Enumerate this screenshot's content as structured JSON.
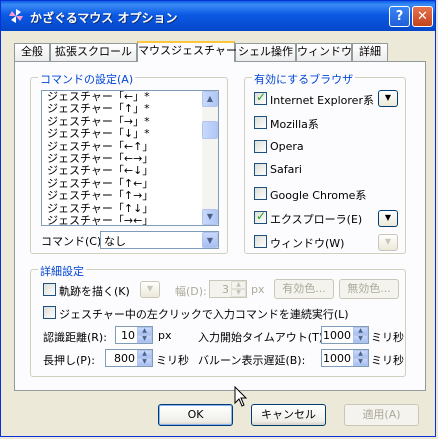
{
  "window": {
    "title": "かざぐるマウス オプション",
    "help_glyph": "?",
    "close_glyph": "✕"
  },
  "tabs": [
    "全般",
    "拡張スクロール",
    "マウスジェスチャー",
    "シェル操作",
    "ウィンドウ",
    "詳細"
  ],
  "active_tab": "マウスジェスチャー",
  "commands": {
    "legend": "コマンドの設定(A)",
    "gestures": [
      "ジェスチャー「←」*",
      "ジェスチャー「↑」*",
      "ジェスチャー「→」*",
      "ジェスチャー「↓」*",
      "ジェスチャー「←↑」",
      "ジェスチャー「←→」",
      "ジェスチャー「←↓」",
      "ジェスチャー「↑←」",
      "ジェスチャー「↑→」",
      "ジェスチャー「↑↓」",
      "ジェスチャー「→←」"
    ],
    "command_label": "コマンド(C):",
    "command_value": "なし"
  },
  "browsers": {
    "legend": "有効にするブラウザ",
    "items": [
      {
        "label": "Internet Explorer系",
        "checked": true,
        "menu": "enabled"
      },
      {
        "label": "Mozilla系",
        "checked": false,
        "menu": "none"
      },
      {
        "label": "Opera",
        "checked": false,
        "menu": "none"
      },
      {
        "label": "Safari",
        "checked": false,
        "menu": "none"
      },
      {
        "label": "Google Chrome系",
        "checked": false,
        "menu": "none"
      },
      {
        "label": "エクスプローラ(E)",
        "checked": true,
        "menu": "enabled"
      },
      {
        "label": "ウィンドウ(W)",
        "checked": false,
        "menu": "disabled"
      }
    ]
  },
  "details": {
    "legend": "詳細設定",
    "trail_label": "軌跡を描く(K)",
    "width_label": "幅(D):",
    "width_value": "3",
    "width_unit": "px",
    "enabled_color_label": "有効色...",
    "disabled_color_label": "無効色...",
    "continuous_label": "ジェスチャー中の左クリックで入力コマンドを連続実行(L)",
    "distance_label": "認識距離(R):",
    "distance_value": "10",
    "distance_unit": "px",
    "timeout_label": "入力開始タイムアウト(T):",
    "timeout_value": "1000",
    "timeout_unit": "ミリ秒",
    "longpress_label": "長押し(P):",
    "longpress_value": "800",
    "longpress_unit": "ミリ秒",
    "balloon_label": "バルーン表示遅延(B):",
    "balloon_value": "1000",
    "balloon_unit": "ミリ秒"
  },
  "buttons": {
    "ok": "OK",
    "cancel": "キャンセル",
    "apply": "適用(A)"
  },
  "glyphs": {
    "down": "▼",
    "up": "▲"
  }
}
